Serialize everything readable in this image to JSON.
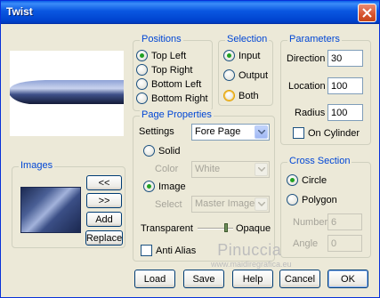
{
  "window": {
    "title": "Twist"
  },
  "positions": {
    "title": "Positions",
    "options": [
      "Top Left",
      "Top Right",
      "Bottom Left",
      "Bottom Right"
    ],
    "selected": "Top Left"
  },
  "selection": {
    "title": "Selection",
    "options": [
      "Input",
      "Output",
      "Both"
    ],
    "selected": "Input"
  },
  "parameters": {
    "title": "Parameters",
    "direction_label": "Direction",
    "direction_value": "30",
    "location_label": "Location",
    "location_value": "100",
    "radius_label": "Radius",
    "radius_value": "100",
    "on_cylinder_label": "On Cylinder"
  },
  "page_properties": {
    "title": "Page Properties",
    "settings_label": "Settings",
    "settings_value": "Fore Page",
    "solid_label": "Solid",
    "color_label": "Color",
    "color_value": "White",
    "image_label": "Image",
    "select_label": "Select",
    "select_value": "Master Image",
    "transparent_label": "Transparent",
    "opaque_label": "Opaque",
    "anti_alias_label": "Anti Alias"
  },
  "cross_section": {
    "title": "Cross Section",
    "circle_label": "Circle",
    "polygon_label": "Polygon",
    "number_label": "Number",
    "number_value": "6",
    "angle_label": "Angle",
    "angle_value": "0"
  },
  "images": {
    "title": "Images",
    "prev_label": "<<",
    "next_label": ">>",
    "add_label": "Add",
    "replace_label": "Replace"
  },
  "buttons": {
    "load": "Load",
    "save": "Save",
    "help": "Help",
    "cancel": "Cancel",
    "ok": "OK"
  },
  "watermark": {
    "line1": "Pinuccia",
    "line2": "www.maidiregrafica.eu"
  }
}
